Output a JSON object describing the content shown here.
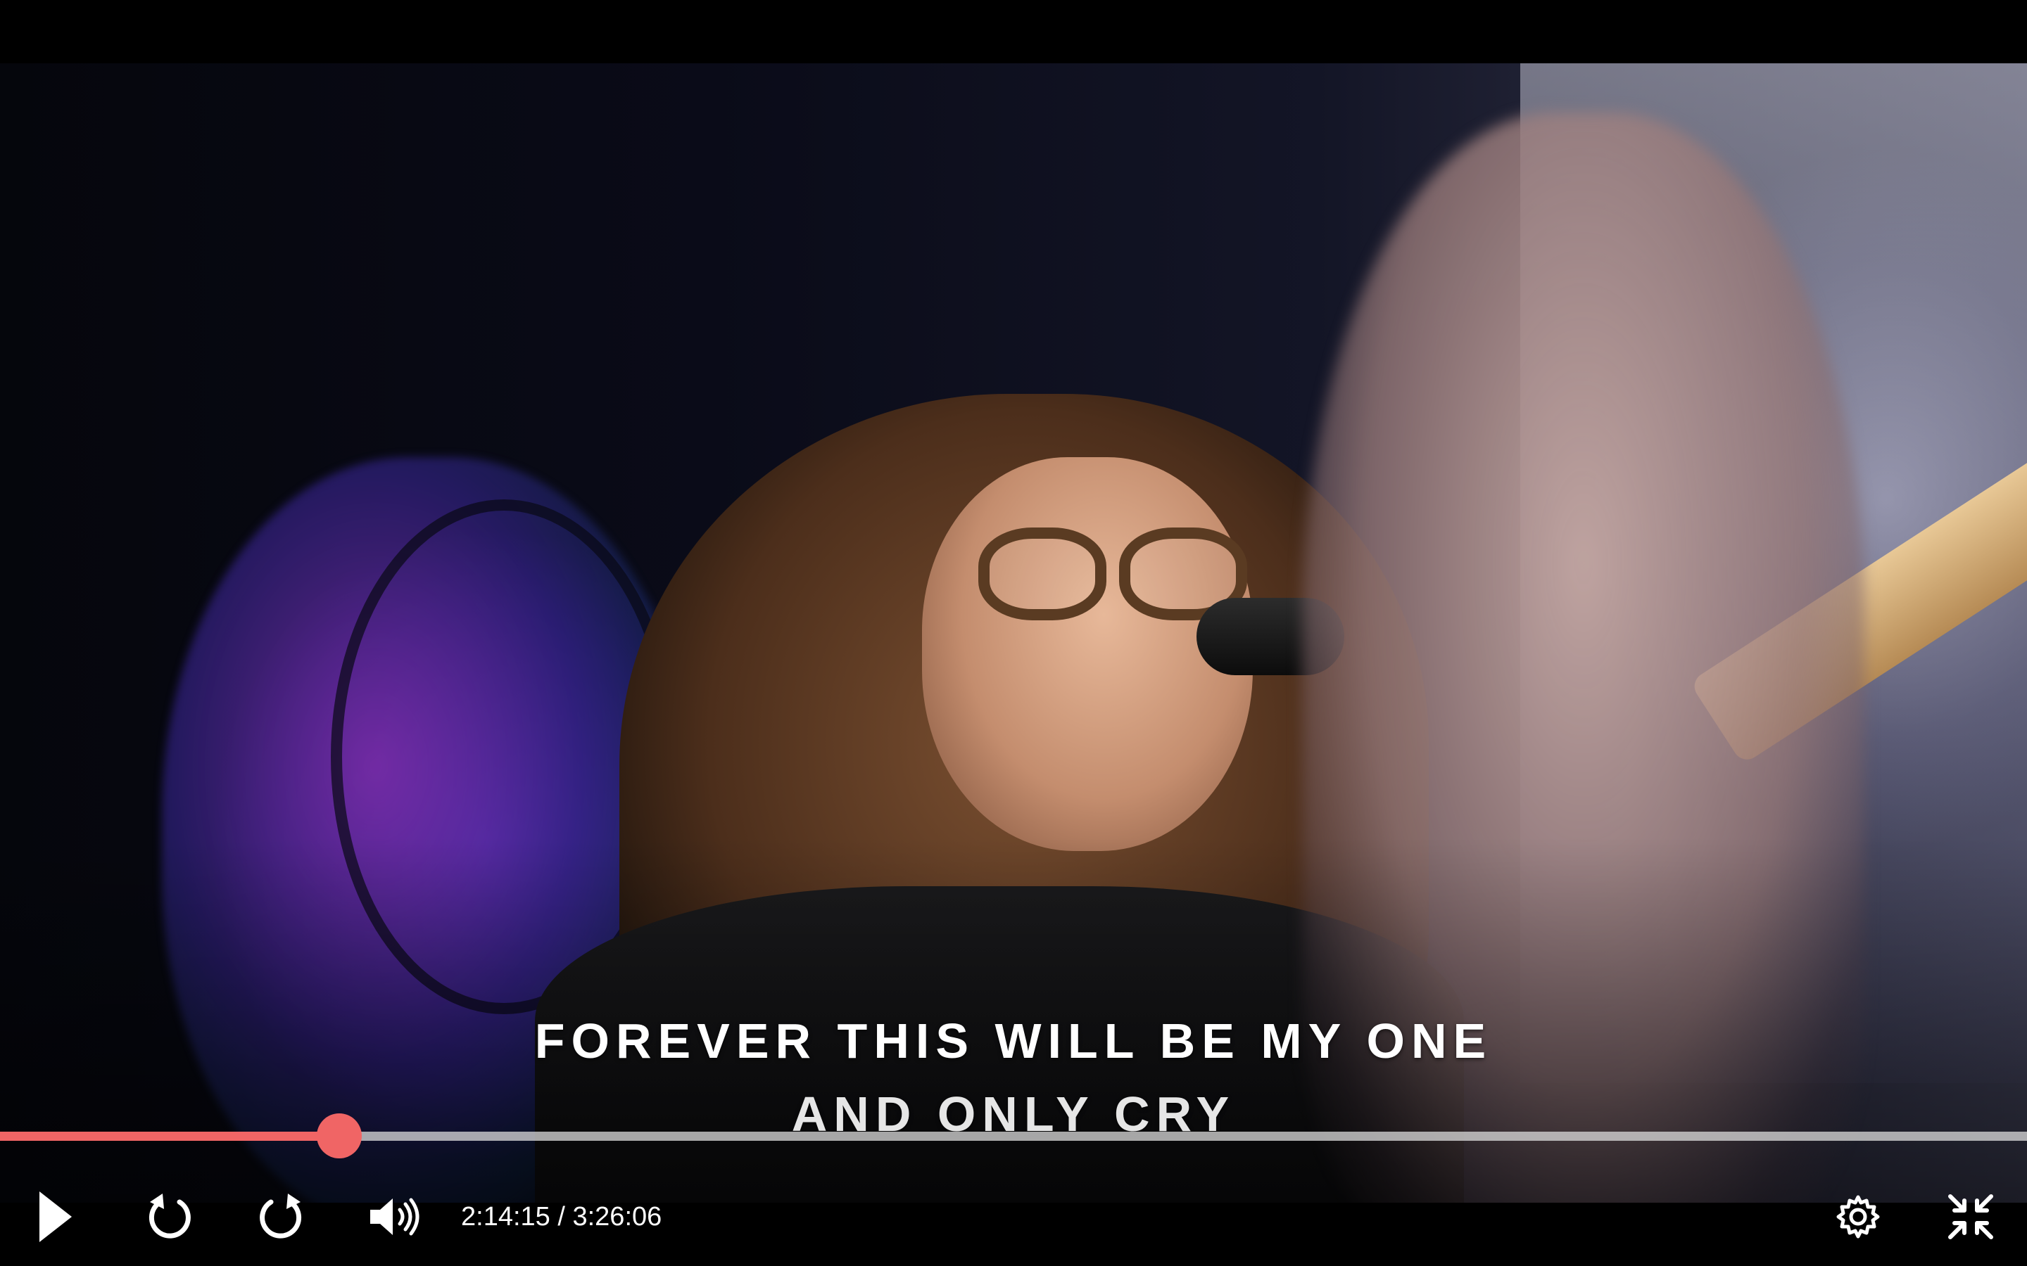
{
  "player": {
    "lyrics": {
      "line1": "FOREVER THIS WILL BE MY ONE",
      "line2": "AND ONLY CRY"
    },
    "current_time": "2:14:15",
    "separator": "/",
    "duration": "3:26:06",
    "progress_fraction": 0.1674,
    "accent_color": "#f06565",
    "icons": {
      "play": "play-icon",
      "rewind": "rewind-icon",
      "forward": "forward-icon",
      "volume": "volume-icon",
      "settings": "gear-icon",
      "exit_fullscreen": "exit-fullscreen-icon"
    }
  }
}
